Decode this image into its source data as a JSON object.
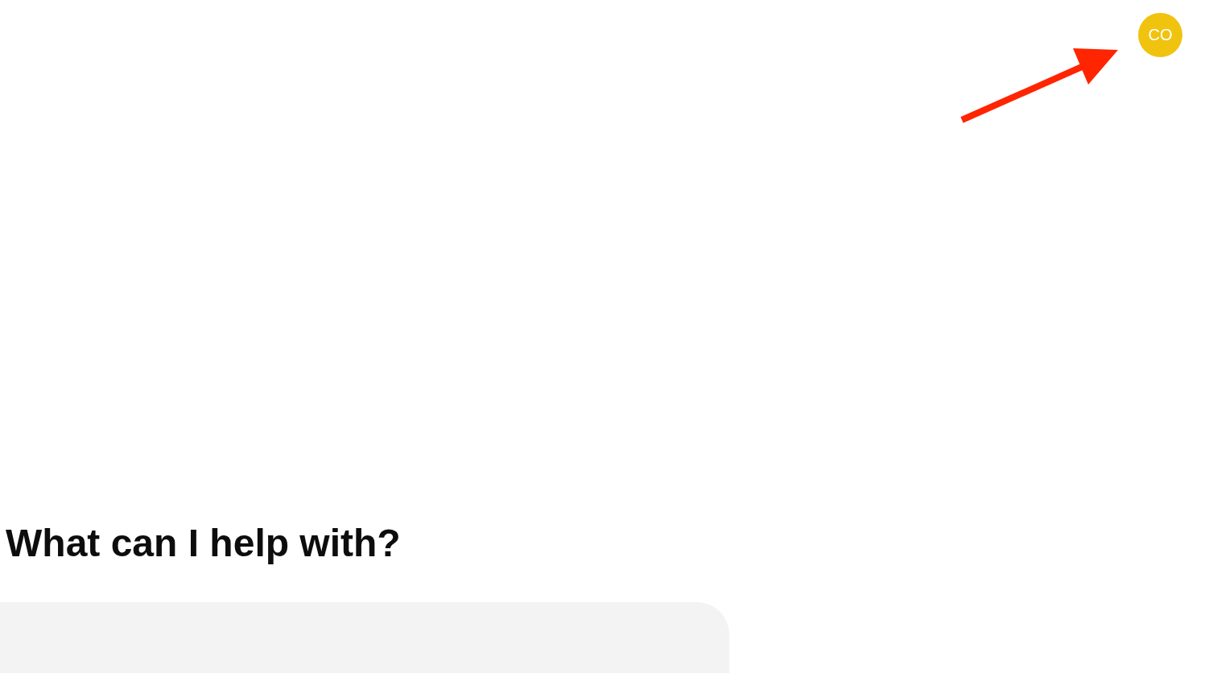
{
  "header": {
    "avatar": {
      "initials": "CO"
    }
  },
  "annotations": [
    {
      "kind": "arrow"
    }
  ],
  "main": {
    "heading": "What can I help with?",
    "composer": {
      "kind": "textarea"
    }
  }
}
